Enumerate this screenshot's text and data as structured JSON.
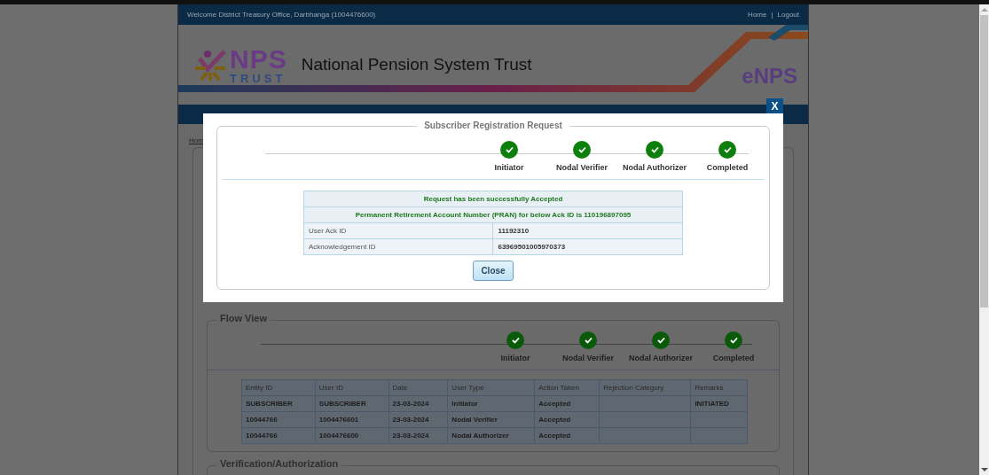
{
  "header": {
    "welcome": "Welcome District Treasury Office, Darbhanga (1004476600)",
    "links": [
      "Home",
      "Logout"
    ],
    "separator": "|"
  },
  "banner": {
    "logo_top": "NPS",
    "logo_bottom": "TRUST",
    "title": "National Pension System Trust",
    "brand": "eNPS"
  },
  "breadcrumb": "Hom",
  "flow_view": {
    "title": "Flow View",
    "steps": [
      {
        "label": "Initiator",
        "completed": true
      },
      {
        "label": "Nodal Verifier",
        "completed": true
      },
      {
        "label": "Nodal Authorizer",
        "completed": true
      },
      {
        "label": "Completed",
        "completed": true
      }
    ],
    "table": {
      "columns": [
        "Entity ID",
        "User ID",
        "Date",
        "User Type",
        "Action Taken",
        "Rejection Category",
        "Remarks"
      ],
      "rows": [
        [
          "SUBSCRIBER",
          "SUBSCRIBER",
          "23-03-2024",
          "Initiator",
          "Accepted",
          "",
          "INITIATED"
        ],
        [
          "10044766",
          "1004476601",
          "23-03-2024",
          "Nodal Verifier",
          "Accepted",
          "",
          ""
        ],
        [
          "10044766",
          "1004476600",
          "23-03-2024",
          "Nodal Authorizer",
          "Accepted",
          "",
          ""
        ]
      ]
    }
  },
  "verification": {
    "title": "Verification/Authorization"
  },
  "modal": {
    "close": "X",
    "legend": "Subscriber Registration Request",
    "steps": [
      {
        "label": "Initiator",
        "completed": true
      },
      {
        "label": "Nodal Verifier",
        "completed": true
      },
      {
        "label": "Nodal Authorizer",
        "completed": true
      },
      {
        "label": "Completed",
        "completed": true
      }
    ],
    "messages": [
      "Request has been successfully Accepted",
      "Permanent Retirement Account Number (PRAN) for below Ack ID is 110196897095"
    ],
    "details": [
      {
        "label": "User Ack ID",
        "value": "11192310"
      },
      {
        "label": "Acknowledgement ID",
        "value": "63969501005970373"
      }
    ],
    "button": "Close"
  }
}
